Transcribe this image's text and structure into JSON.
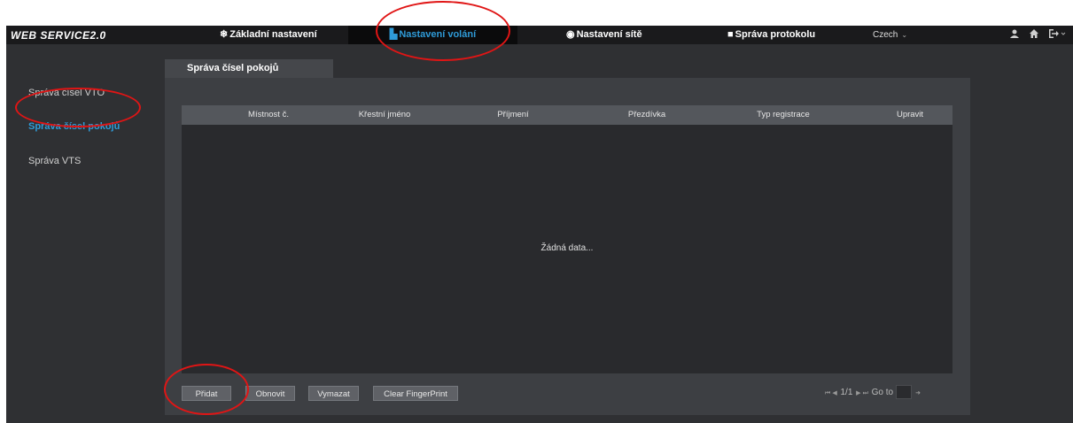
{
  "app": {
    "logo": "WEB SERVICE2.0"
  },
  "topnav": {
    "items": [
      {
        "label": "Základní nastavení",
        "icon": "gear-icon",
        "glyph": "❄",
        "active": false
      },
      {
        "label": "Nastavení volání",
        "icon": "building-icon",
        "glyph": "▙",
        "active": true
      },
      {
        "label": "Nastavení sítě",
        "icon": "globe-icon",
        "glyph": "◉",
        "active": false
      },
      {
        "label": "Správa protokolu",
        "icon": "document-icon",
        "glyph": "■",
        "active": false
      }
    ],
    "language": "Czech",
    "user_icon": "user-icon",
    "home_icon": "home-icon",
    "logout_icon": "logout-icon"
  },
  "sidebar": {
    "items": [
      {
        "label": "Správa čísel VTO",
        "active": false
      },
      {
        "label": "Správa čísel pokojů",
        "active": true
      },
      {
        "label": "Správa VTS",
        "active": false
      }
    ]
  },
  "tab": {
    "label": "Správa čísel pokojů"
  },
  "table": {
    "columns": [
      "Místnost č.",
      "Křestní jméno",
      "Příjmení",
      "Přezdívka",
      "Typ registrace",
      "Upravit"
    ],
    "rows": [],
    "empty_text": "Žádná data..."
  },
  "buttons": {
    "add": "Přidat",
    "refresh": "Obnovit",
    "clear": "Vymazat",
    "clear_fingerprint": "Clear FingerPrint"
  },
  "pager": {
    "page": "1/1",
    "goto_label": "Go to",
    "goto_value": ""
  },
  "annotation_color": "#e01515"
}
